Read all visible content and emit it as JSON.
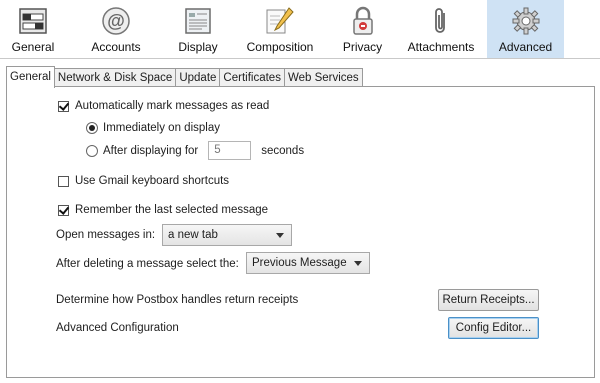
{
  "toolbar": {
    "items": [
      {
        "label": "General",
        "icon": "general-icon"
      },
      {
        "label": "Accounts",
        "icon": "at-icon"
      },
      {
        "label": "Display",
        "icon": "display-icon"
      },
      {
        "label": "Composition",
        "icon": "pencil-icon"
      },
      {
        "label": "Privacy",
        "icon": "lock-icon"
      },
      {
        "label": "Attachments",
        "icon": "paperclip-icon"
      },
      {
        "label": "Advanced",
        "icon": "gear-icon"
      }
    ],
    "active": "Advanced",
    "active_color": "#cfe2f4"
  },
  "tabs": [
    "General",
    "Network & Disk Space",
    "Update",
    "Certificates",
    "Web Services"
  ],
  "selected_tab": "General",
  "general": {
    "auto_mark_label": "Automatically mark messages as read",
    "auto_mark_checked": true,
    "immediately_label": "Immediately on display",
    "after_label": "After displaying for",
    "after_value": "5",
    "seconds_label": "seconds",
    "gmail_label": "Use Gmail keyboard shortcuts",
    "gmail_checked": false,
    "remember_label": "Remember the last selected message",
    "remember_checked": true,
    "open_in_label": "Open messages in:",
    "open_in_value": "a new tab",
    "after_delete_label": "After deleting a message select the:",
    "after_delete_value": "Previous Message",
    "receipts_label": "Determine how Postbox handles return receipts",
    "receipts_button": "Return Receipts...",
    "advanced_config_label": "Advanced Configuration",
    "config_button": "Config Editor..."
  }
}
